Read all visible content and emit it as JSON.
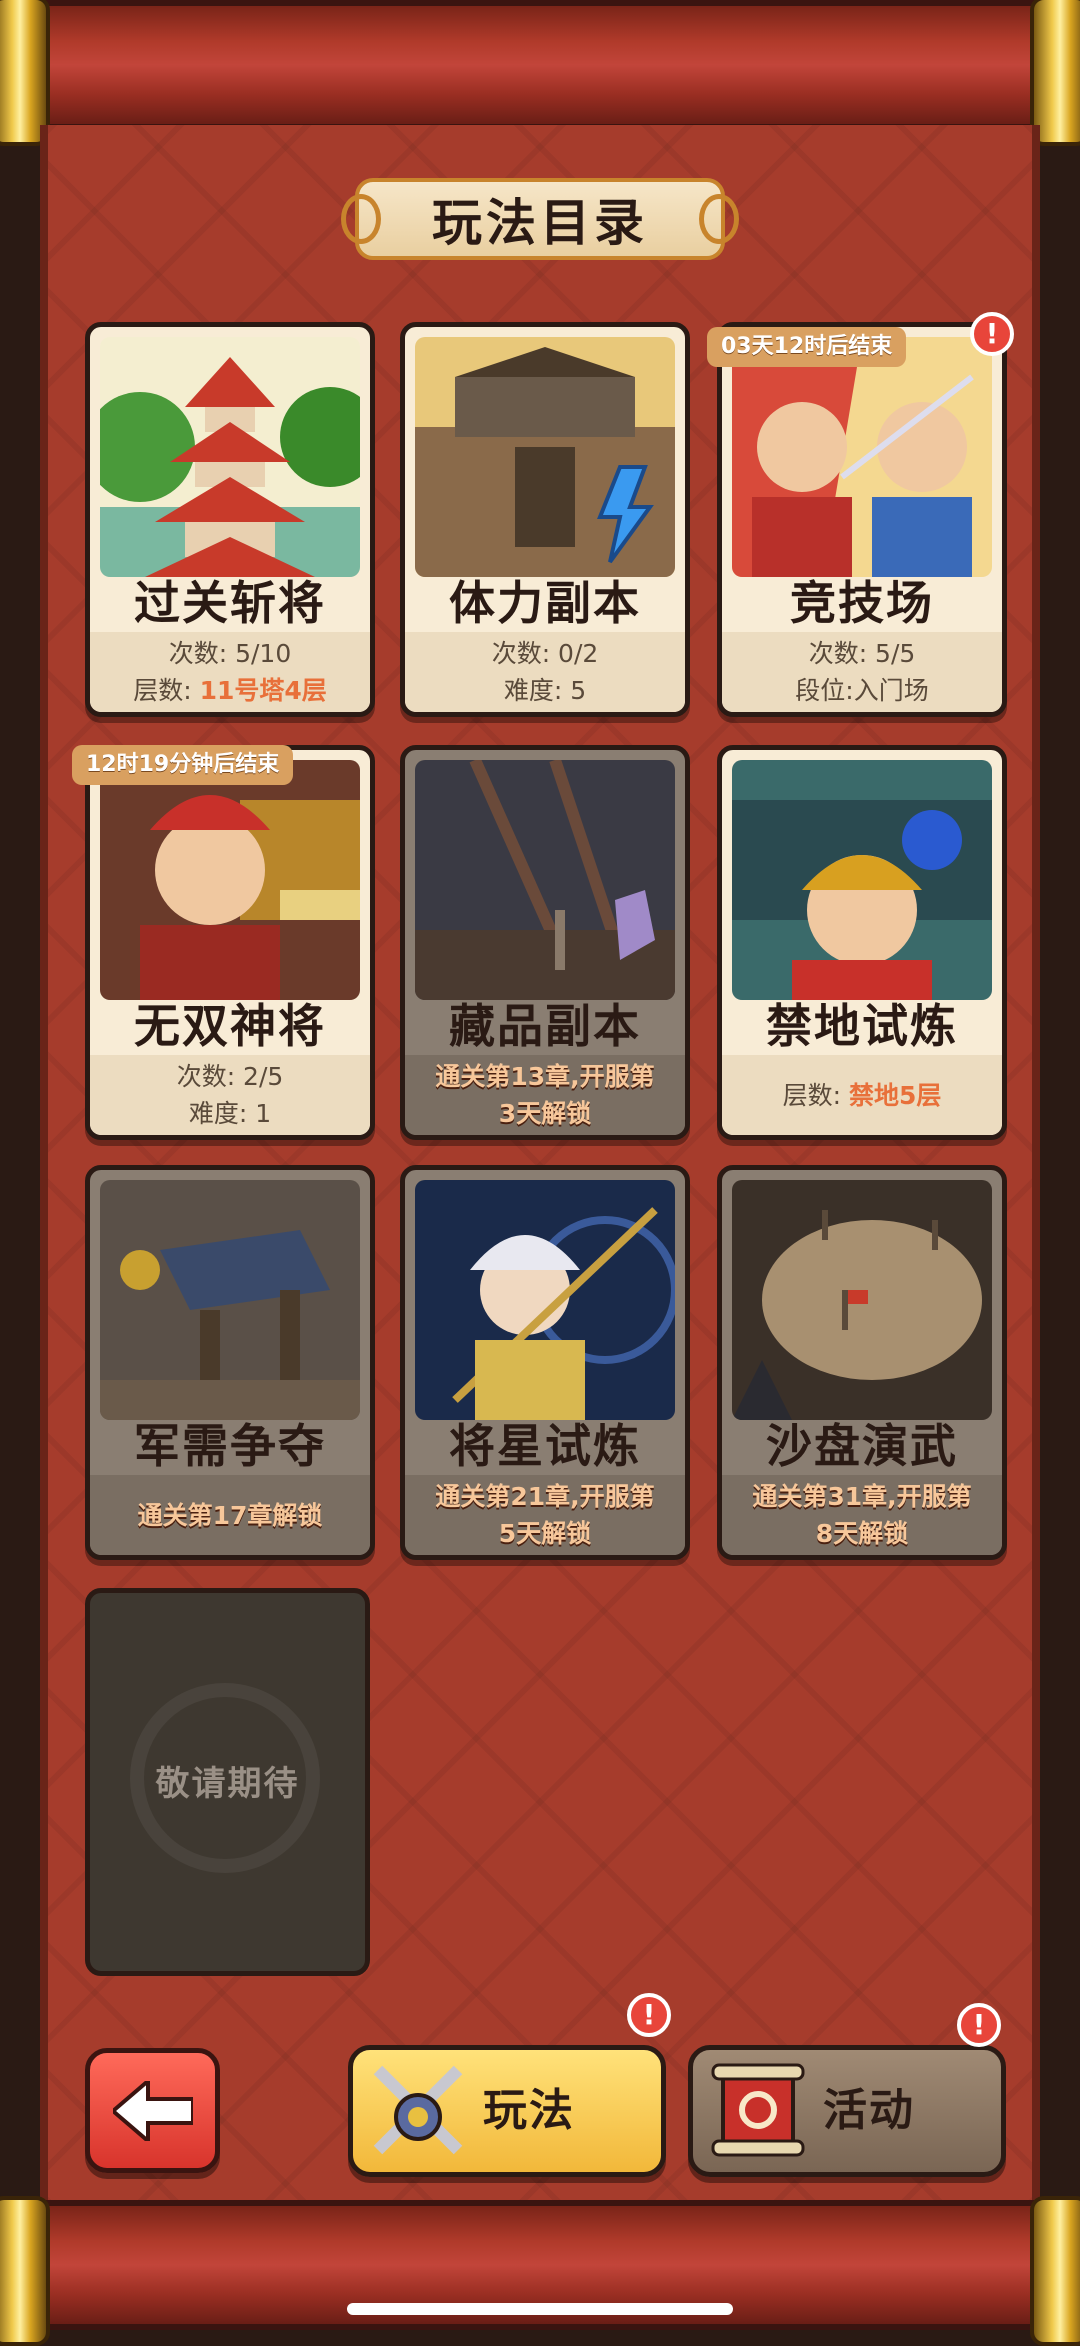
{
  "title": "玩法目录",
  "cards": [
    {
      "name": "过关斩将",
      "info_line1": "次数: 5/10",
      "info_line2_prefix": "层数: ",
      "info_line2_highlight": "11号塔4层",
      "timer": "",
      "badge": ""
    },
    {
      "name": "体力副本",
      "info_line1": "次数: 0/2",
      "info_line2": "难度: 5",
      "timer": "",
      "badge": ""
    },
    {
      "name": "竞技场",
      "info_line1": "次数: 5/5",
      "info_line2": "段位:入门场",
      "timer": "03天12时后结束",
      "badge": "!"
    },
    {
      "name": "无双神将",
      "info_line1": "次数: 2/5",
      "info_line2": "难度: 1",
      "timer": "12时19分钟后结束",
      "badge": ""
    },
    {
      "name": "藏品副本",
      "locked_line1": "通关第13章,开服第",
      "locked_line2": "3天解锁"
    },
    {
      "name": "禁地试炼",
      "info_line2_prefix": "层数: ",
      "info_line2_highlight": "禁地5层"
    },
    {
      "name": "军需争夺",
      "locked_line1": "通关第17章解锁"
    },
    {
      "name": "将星试炼",
      "locked_line1": "通关第21章,开服第",
      "locked_line2": "5天解锁"
    },
    {
      "name": "沙盘演武",
      "locked_line1": "通关第31章,开服第",
      "locked_line2": "8天解锁"
    }
  ],
  "empty_slot": "敬请期待",
  "bottom_nav": {
    "play_label": "玩法",
    "event_label": "活动",
    "play_badge": "!",
    "event_badge": "!"
  },
  "colors": {
    "highlight": "#e8703a",
    "badge": "#e8453a",
    "panel": "#a63c2c"
  }
}
